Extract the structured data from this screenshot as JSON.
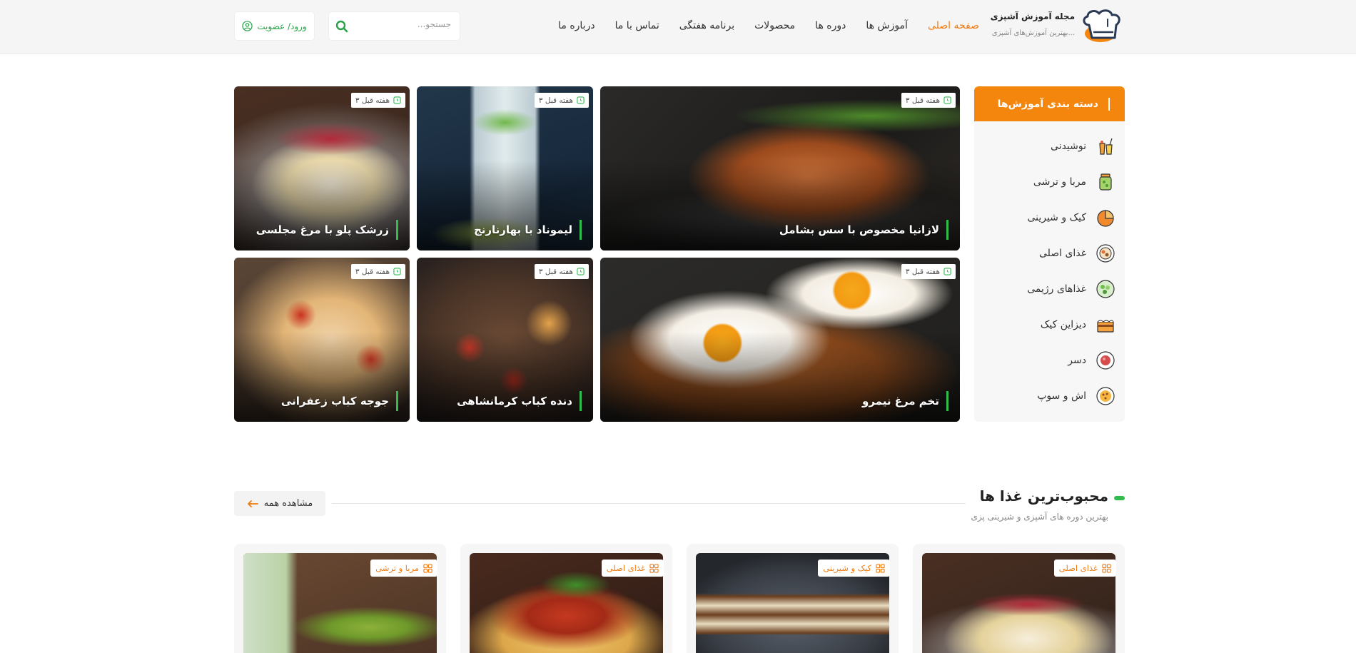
{
  "header": {
    "logo_title": "مجله آموزش آشپزی",
    "logo_subtitle": "بهترین آموزش‌های آشپزی...",
    "nav": [
      {
        "label": "صفحه اصلی",
        "active": true
      },
      {
        "label": "آموزش ها",
        "active": false
      },
      {
        "label": "دوره ها",
        "active": false
      },
      {
        "label": "محصولات",
        "active": false
      },
      {
        "label": "برنامه هفتگی",
        "active": false
      },
      {
        "label": "تماس با ما",
        "active": false
      },
      {
        "label": "درباره ما",
        "active": false
      }
    ],
    "search_placeholder": "جستجو...",
    "login_label": "ورود/ عضویت"
  },
  "sidebar": {
    "title": "دسته بندی آموزش‌ها",
    "items": [
      {
        "label": "نوشیدنی",
        "icon": "drink-icon"
      },
      {
        "label": "مربا و ترشی",
        "icon": "jar-icon"
      },
      {
        "label": "کیک و شیرینی",
        "icon": "cookie-icon"
      },
      {
        "label": "غذای اصلی",
        "icon": "main-dish-icon"
      },
      {
        "label": "غذاهای رژیمی",
        "icon": "salad-icon"
      },
      {
        "label": "دیزاین کیک",
        "icon": "cake-icon"
      },
      {
        "label": "دسر",
        "icon": "dessert-icon"
      },
      {
        "label": "اش و سوپ",
        "icon": "soup-icon"
      }
    ]
  },
  "featured": [
    {
      "title": "لازانیا مخصوص با سس بشامل",
      "time": "۳ هفته قبل"
    },
    {
      "title": "لیموناد با بهارنارنج",
      "time": "۳ هفته قبل"
    },
    {
      "title": "زرشک پلو با مرغ مجلسی",
      "time": "۳ هفته قبل"
    },
    {
      "title": "تخم مرغ نیمرو",
      "time": "۳ هفته قبل"
    },
    {
      "title": "دنده کباب کرمانشاهی",
      "time": "۳ هفته قبل"
    },
    {
      "title": "جوجه کباب زعفرانی",
      "time": "۳ هفته قبل"
    }
  ],
  "popular": {
    "title": "محبوب‌ترین غذا ها",
    "subtitle": "بهترین دوره های آشپزی و شیرینی پزی",
    "see_all": "مشاهده همه",
    "cards": [
      {
        "category": "غذای اصلی"
      },
      {
        "category": "کیک و شیرینی"
      },
      {
        "category": "غذای اصلی"
      },
      {
        "category": "مربا و ترشی"
      }
    ]
  },
  "colors": {
    "accent": "#f07d14",
    "sidebar_header": "#f4860d",
    "green": "#2fbd4e"
  }
}
